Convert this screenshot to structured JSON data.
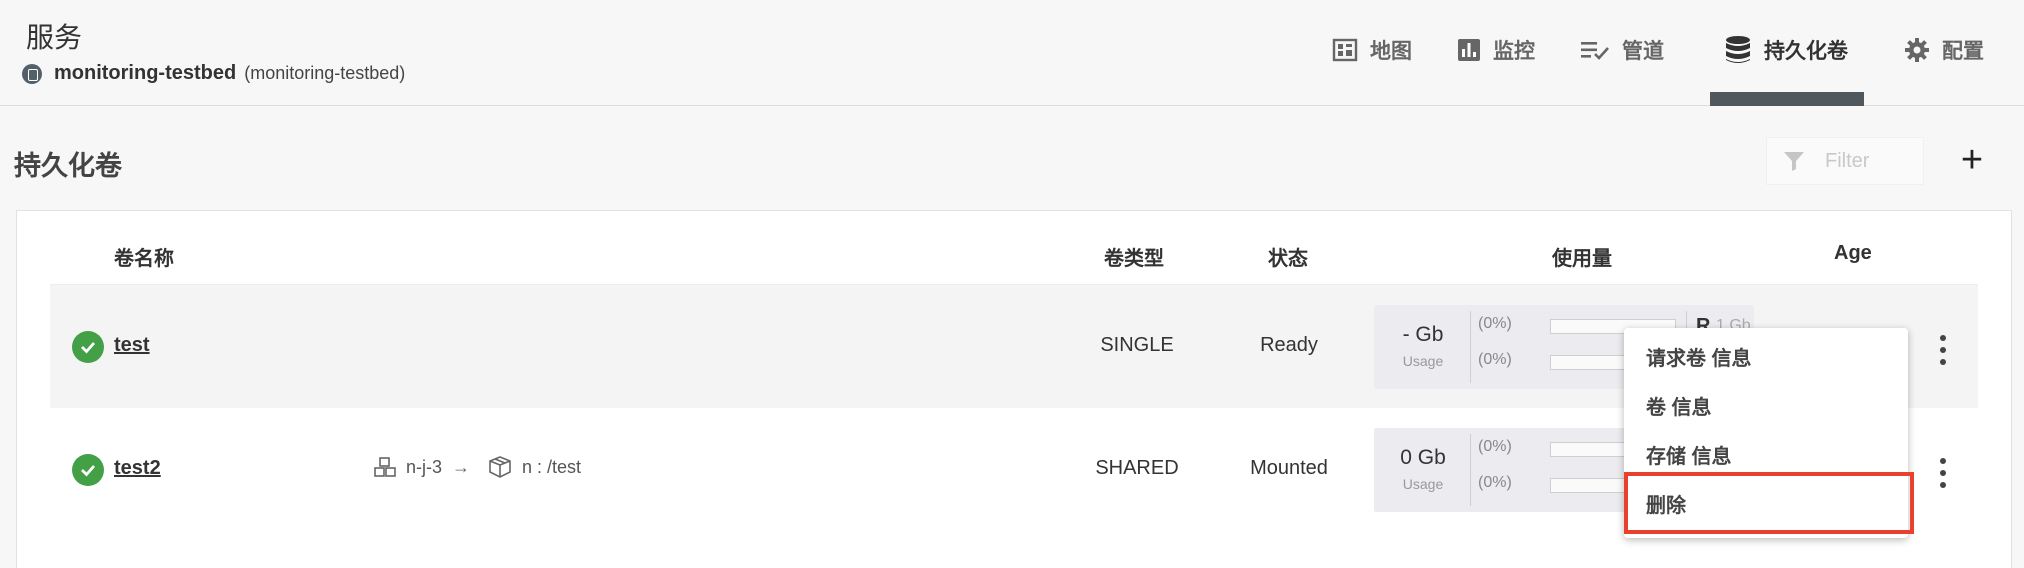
{
  "header": {
    "title": "服务",
    "project_name": "monitoring-testbed",
    "project_id": "(monitoring-testbed)",
    "nav": {
      "map": "地图",
      "monitor": "监控",
      "pipelines": "管道",
      "volumes": "持久化卷",
      "config": "配置"
    }
  },
  "toolbar": {
    "title": "持久化卷",
    "filter_placeholder": "Filter",
    "add_label": "+"
  },
  "table": {
    "columns": {
      "name": "卷名称",
      "type": "卷类型",
      "state": "状态",
      "usage": "使用量",
      "age": "Age"
    },
    "rows": [
      {
        "name": "test",
        "type": "SINGLE",
        "state": "Ready",
        "usage_value": "- Gb",
        "usage_label": "Usage",
        "pct1": "(0%)",
        "pct2": "(0%)",
        "right_label": "R",
        "right_sub": "1 Gb"
      },
      {
        "name": "test2",
        "node": "n-j-3",
        "mount": "n : /test",
        "type": "SHARED",
        "state": "Mounted",
        "usage_value": "0 Gb",
        "usage_label": "Usage",
        "pct1": "(0%)",
        "pct2": "(0%)"
      }
    ]
  },
  "context_menu": {
    "items": [
      "请求卷 信息",
      "卷 信息",
      "存储 信息",
      "删除"
    ],
    "highlighted": "删除",
    "highlight_color": "#e8412e"
  },
  "colors": {
    "status_ok": "#43a047",
    "active_tab_bar": "#50575d"
  }
}
